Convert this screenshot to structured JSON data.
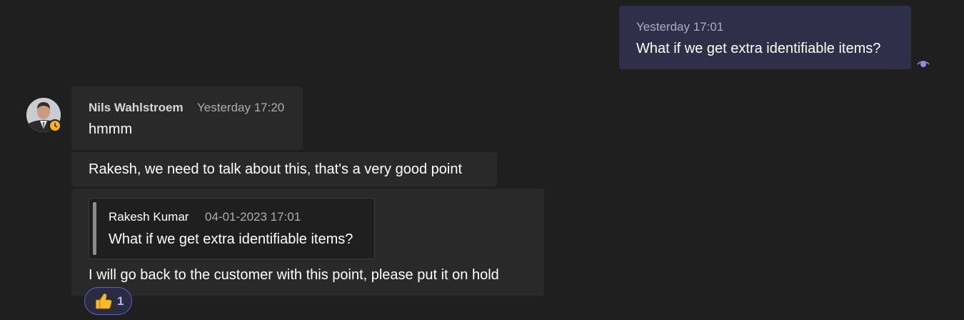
{
  "outgoing_message": {
    "timestamp": "Yesterday 17:01",
    "text": "What if we get extra identifiable items?",
    "status_icon": "read-receipt-eye-icon"
  },
  "incoming_thread": {
    "author": "Nils Wahlstroem",
    "presence": "away",
    "timestamp": "Yesterday 17:20",
    "messages": [
      {
        "text": "hmmm"
      },
      {
        "text": "Rakesh, we need to talk about this, that's a very good point"
      },
      {
        "quote": {
          "author": "Rakesh Kumar",
          "timestamp": "04-01-2023 17:01",
          "text": "What if we get extra identifiable items?"
        },
        "text": "I will go back to the customer with this point, please put it on hold"
      }
    ],
    "reaction": {
      "icon": "thumbs-up-icon",
      "count": "1"
    }
  },
  "colors": {
    "background": "#1f1f1f",
    "outgoing_bubble": "#2f2f4a",
    "incoming_bubble": "#292929",
    "accent": "#5b5fc7",
    "away_status": "#f8b515"
  }
}
